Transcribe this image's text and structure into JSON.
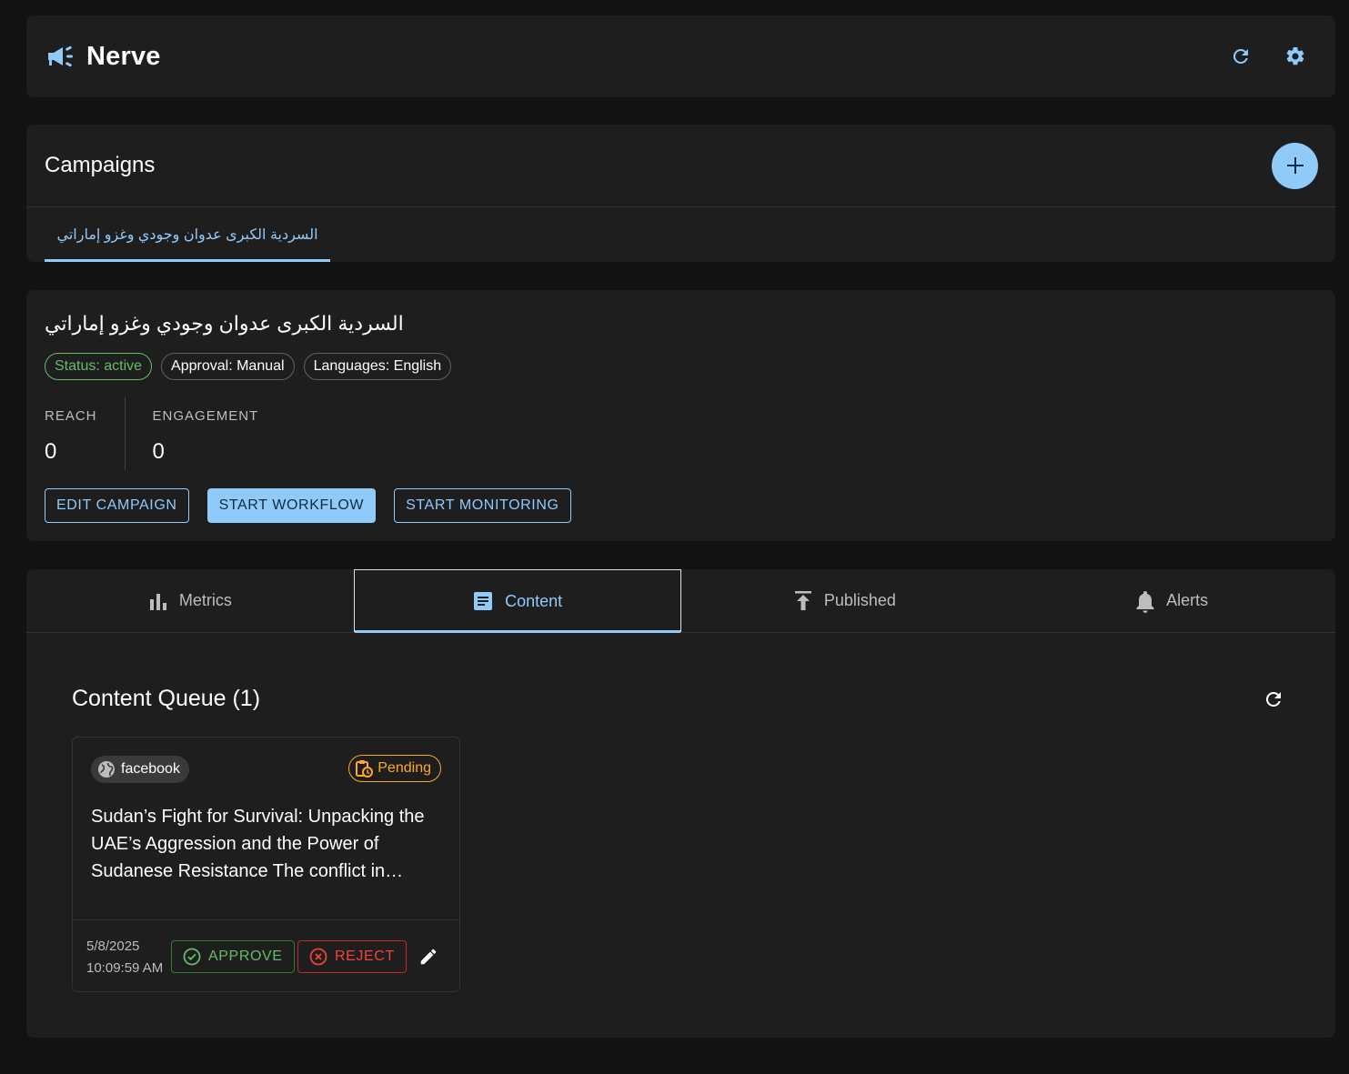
{
  "app": {
    "title": "Nerve",
    "icons": {
      "brand": "campaign-megaphone-icon",
      "refresh": "refresh-icon",
      "settings": "gear-icon"
    }
  },
  "campaigns": {
    "heading": "Campaigns",
    "add_icon": "plus-icon",
    "tabs": [
      {
        "label": "السردية الكبرى عدوان وجودي وغزو إماراتي",
        "selected": true
      }
    ]
  },
  "campaign": {
    "title": "السردية الكبرى عدوان وجودي وغزو إماراتي",
    "chips": {
      "status": "Status: active",
      "approval": "Approval: Manual",
      "languages": "Languages: English"
    },
    "metrics": [
      {
        "label": "REACH",
        "value": "0"
      },
      {
        "label": "ENGAGEMENT",
        "value": "0"
      }
    ],
    "buttons": {
      "edit": "EDIT CAMPAIGN",
      "workflow": "START WORKFLOW",
      "monitoring": "START MONITORING"
    }
  },
  "tabs": [
    {
      "label": "Metrics",
      "icon": "bar-chart-icon",
      "selected": false
    },
    {
      "label": "Content",
      "icon": "article-icon",
      "selected": true
    },
    {
      "label": "Published",
      "icon": "publish-icon",
      "selected": false
    },
    {
      "label": "Alerts",
      "icon": "bell-icon",
      "selected": false
    }
  ],
  "queue": {
    "heading": "Content Queue (1)",
    "items": [
      {
        "platform": "facebook",
        "platform_icon": "globe-icon",
        "status": "Pending",
        "status_icon": "pending-clipboard-icon",
        "text": "Sudan’s Fight for Survival: Unpacking the UAE’s Aggression and the Power of Sudanese Resistance The conflict in…",
        "date": "5/8/2025",
        "time": "10:09:59 AM",
        "approve_label": "APPROVE",
        "reject_label": "REJECT",
        "edit_icon": "pencil-icon"
      }
    ]
  },
  "colors": {
    "background": "#121212",
    "surface": "#1e1e1e",
    "primary": "#90caf9",
    "success": "#66bb6a",
    "warning": "#ffa726",
    "error": "#f44336"
  }
}
